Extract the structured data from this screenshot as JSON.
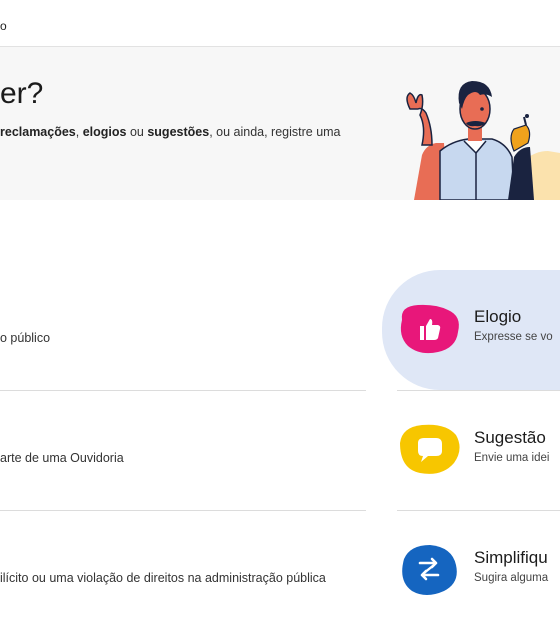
{
  "topbar": {
    "text": "o"
  },
  "hero": {
    "title": "er?",
    "text_parts": [
      "reclamações",
      ", ",
      "elogios",
      " ou ",
      "sugestões",
      ", ou ainda, registre uma"
    ]
  },
  "left_items": [
    {
      "desc": "o público"
    },
    {
      "desc": "arte de uma Ouvidoria"
    },
    {
      "desc": "ilícito ou uma violação de direitos na administração pública"
    }
  ],
  "cards": [
    {
      "title": "Elogio",
      "desc": "Expresse se vo",
      "color": "#e8177a",
      "icon": "thumbs-up-icon"
    },
    {
      "title": "Sugestão",
      "desc": "Envie uma idei",
      "color": "#f7c600",
      "icon": "speech-bubble-icon"
    },
    {
      "title": "Simplifiqu",
      "desc": "Sugira alguma",
      "color": "#1565c0",
      "icon": "swap-arrows-icon"
    }
  ]
}
